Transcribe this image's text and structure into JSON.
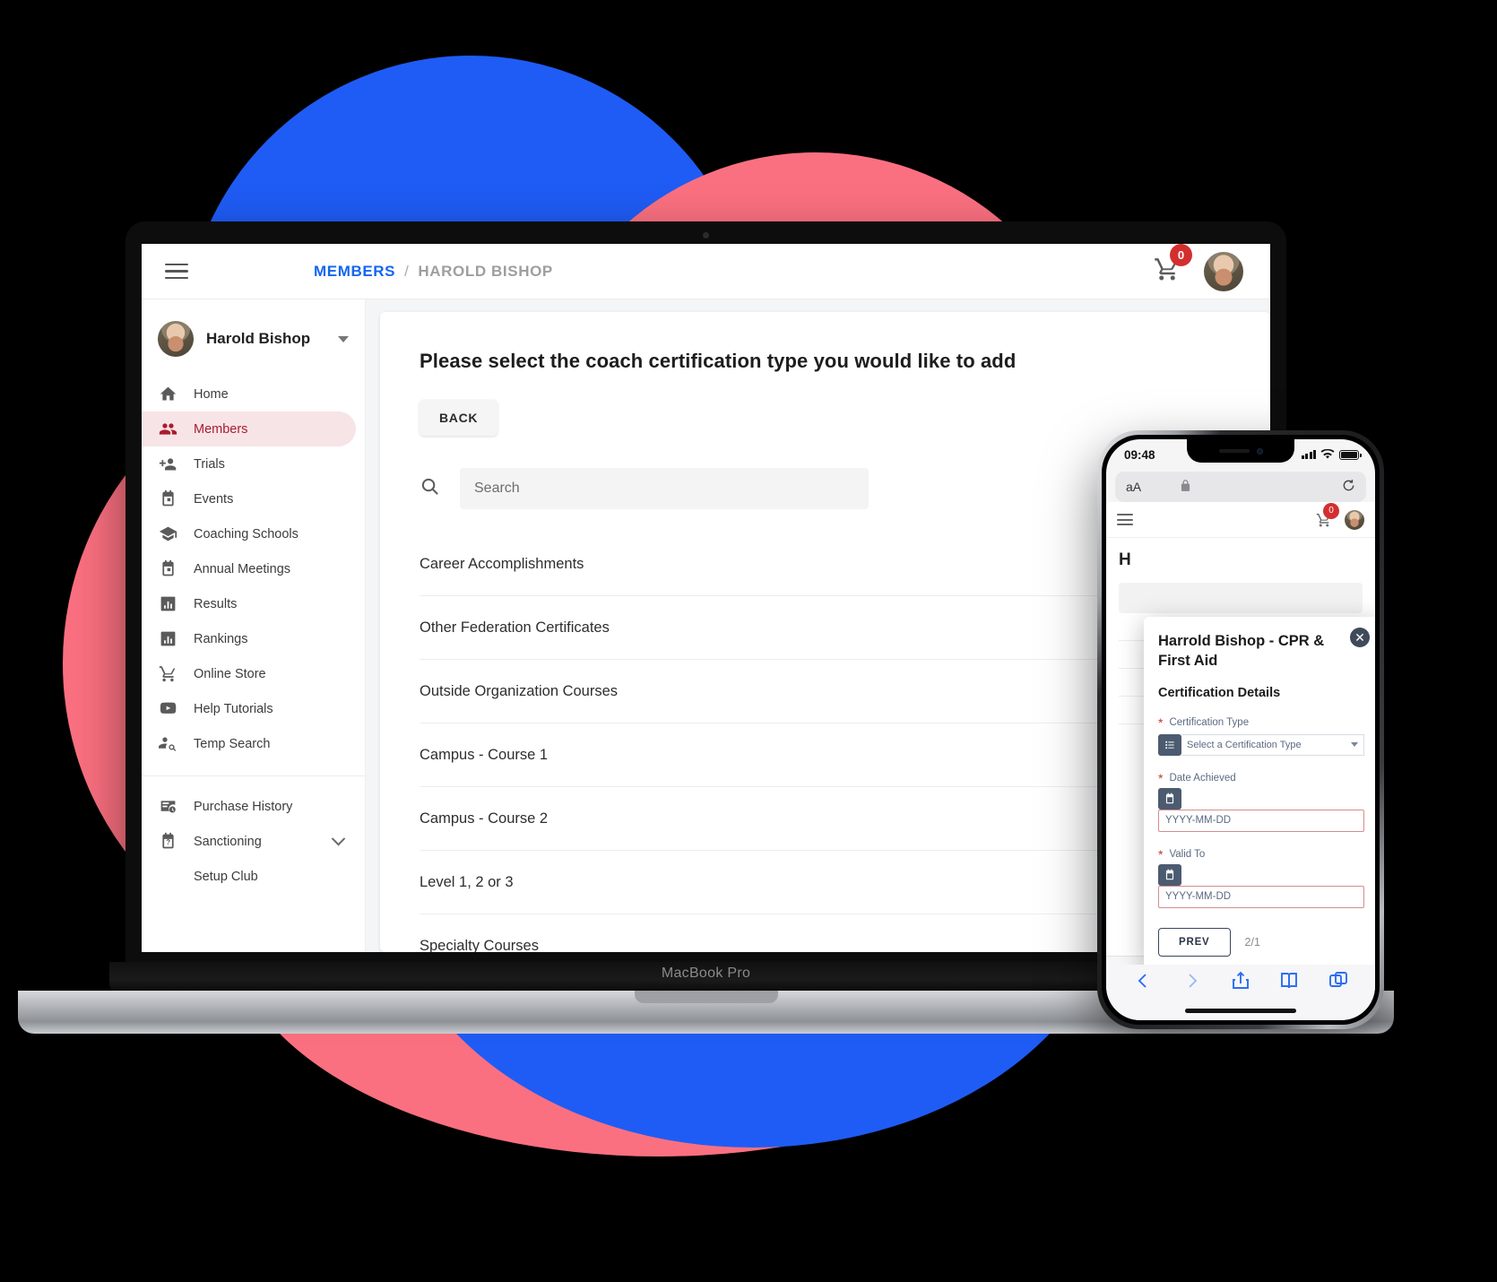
{
  "desktop": {
    "device_label": "MacBook Pro",
    "topbar": {
      "menu_icon": "hamburger-icon",
      "breadcrumb_current": "MEMBERS",
      "breadcrumb_sep": "/",
      "breadcrumb_page": "HAROLD BISHOP",
      "cart_icon": "cart-icon",
      "cart_badge": "0",
      "avatar_icon": "user-avatar"
    },
    "sidebar": {
      "profile_name": "Harold Bishop",
      "profile_caret": "chevron-down-icon",
      "items": [
        {
          "label": "Home",
          "icon": "home-icon",
          "active": false
        },
        {
          "label": "Members",
          "icon": "people-icon",
          "active": true
        },
        {
          "label": "Trials",
          "icon": "person-add-icon",
          "active": false
        },
        {
          "label": "Events",
          "icon": "calendar-icon",
          "active": false
        },
        {
          "label": "Coaching Schools",
          "icon": "graduation-cap-icon",
          "active": false
        },
        {
          "label": "Annual Meetings",
          "icon": "calendar-icon",
          "active": false
        },
        {
          "label": "Results",
          "icon": "bar-chart-icon",
          "active": false
        },
        {
          "label": "Rankings",
          "icon": "bar-chart-icon",
          "active": false
        },
        {
          "label": "Online Store",
          "icon": "cart-icon",
          "active": false
        },
        {
          "label": "Help Tutorials",
          "icon": "youtube-icon",
          "active": false
        },
        {
          "label": "Temp Search",
          "icon": "person-search-icon",
          "active": false
        }
      ],
      "items2": [
        {
          "label": "Purchase History",
          "icon": "receipt-clock-icon",
          "expandable": false
        },
        {
          "label": "Sanctioning",
          "icon": "calendar-question-icon",
          "expandable": true
        },
        {
          "label": "Setup Club",
          "icon": "",
          "expandable": false
        }
      ]
    },
    "main": {
      "title": "Please select the coach certification type you would like to add",
      "back_label": "BACK",
      "search_icon": "search-icon",
      "search_value": "",
      "search_placeholder": "Search",
      "cert_types": [
        "Career Accomplishments",
        "Other Federation Certificates",
        "Outside Organization Courses",
        "Campus - Course 1",
        "Campus - Course 2",
        "Level 1, 2 or 3",
        "Specialty Courses"
      ]
    }
  },
  "phone": {
    "status": {
      "time": "09:48",
      "signal_icon": "cellular-signal-icon",
      "wifi_icon": "wifi-icon",
      "battery_icon": "battery-icon"
    },
    "safari": {
      "text_size_label": "aA",
      "lock_icon": "lock-icon",
      "reload_icon": "reload-icon",
      "back_icon": "chevron-left-icon",
      "forward_icon": "chevron-right-icon",
      "share_icon": "share-icon",
      "bookmarks_icon": "book-icon",
      "tabs_icon": "tabs-icon"
    },
    "page": {
      "menu_icon": "hamburger-icon",
      "cart_icon": "cart-icon",
      "cart_badge": "0",
      "avatar_icon": "user-avatar",
      "heading": "H"
    },
    "modal": {
      "close_icon": "close-icon",
      "title": "Harrold Bishop - CPR & First Aid",
      "subtitle": "Certification Details",
      "fields": [
        {
          "label": "Certification Type",
          "required": "*",
          "type": "select",
          "addon_icon": "list-icon",
          "value": "Select a Certification Type",
          "caret_icon": "chevron-down-icon"
        },
        {
          "label": "Date Achieved",
          "required": "*",
          "type": "date",
          "addon_icon": "calendar-icon",
          "value": "",
          "placeholder": "YYYY-MM-DD"
        },
        {
          "label": "Valid To",
          "required": "*",
          "type": "date",
          "addon_icon": "calendar-icon",
          "value": "",
          "placeholder": "YYYY-MM-DD"
        }
      ],
      "prev_label": "PREV",
      "page_count": "2/1"
    }
  },
  "colors": {
    "brand_blue": "#1565f0",
    "accent_red": "#a81c30",
    "badge_red": "#d32f2f",
    "blob_blue": "#1f5cf5",
    "blob_pink": "#fb7080",
    "modal_navy": "#2c3648"
  }
}
